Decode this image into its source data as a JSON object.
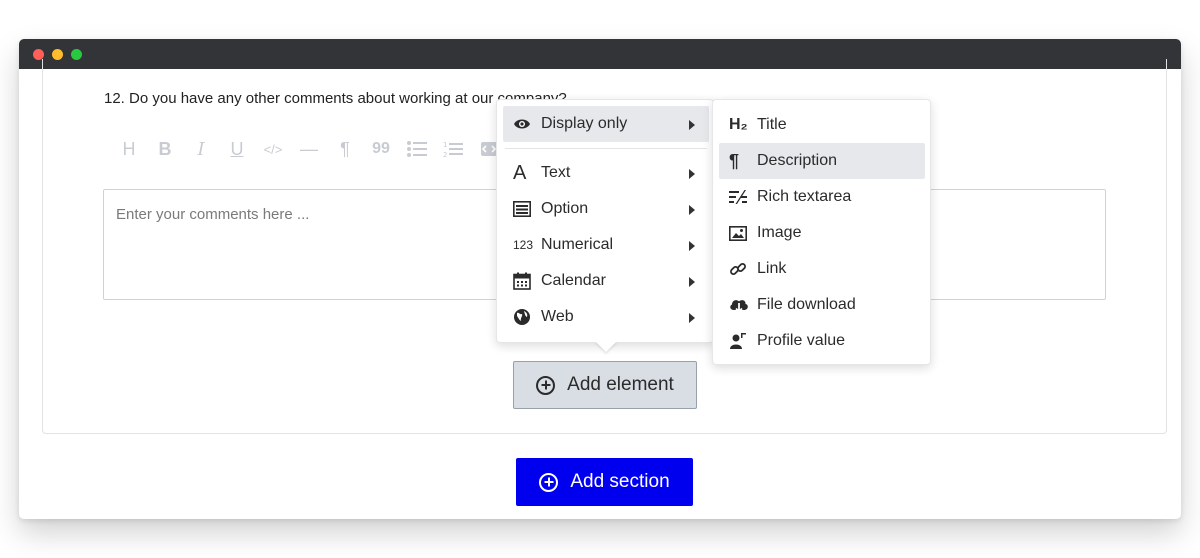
{
  "form": {
    "question": "12. Do you have any other comments about working at our company?",
    "placeholder": "Enter your comments here ...",
    "toolbar": [
      "H",
      "B",
      "I",
      "U",
      "</>",
      "—",
      "¶",
      "99",
      "bullets",
      "numbered",
      "embed"
    ]
  },
  "buttons": {
    "add_element": "Add element",
    "add_section": "Add section"
  },
  "type_menu": {
    "items": [
      {
        "label": "Display only",
        "icon": "eye-icon",
        "active": true
      },
      {
        "label": "Text",
        "icon": "letter-a-icon"
      },
      {
        "label": "Option",
        "icon": "list-box-icon"
      },
      {
        "label": "Numerical",
        "icon": "numbers-icon",
        "glyph": "123"
      },
      {
        "label": "Calendar",
        "icon": "calendar-icon"
      },
      {
        "label": "Web",
        "icon": "globe-icon"
      }
    ]
  },
  "display_submenu": {
    "items": [
      {
        "label": "Title",
        "icon": "heading-icon",
        "glyph": "H₂"
      },
      {
        "label": "Description",
        "icon": "pilcrow-icon",
        "glyph": "¶",
        "active": true
      },
      {
        "label": "Rich textarea",
        "icon": "rich-text-icon"
      },
      {
        "label": "Image",
        "icon": "image-icon"
      },
      {
        "label": "Link",
        "icon": "link-icon"
      },
      {
        "label": "File download",
        "icon": "cloud-download-icon"
      },
      {
        "label": "Profile value",
        "icon": "profile-icon"
      }
    ]
  },
  "colors": {
    "titlebar": "#333438",
    "primary_button": "#0000ee",
    "secondary_button": "#d9dee5",
    "menu_hover": "#e6e8ec"
  }
}
